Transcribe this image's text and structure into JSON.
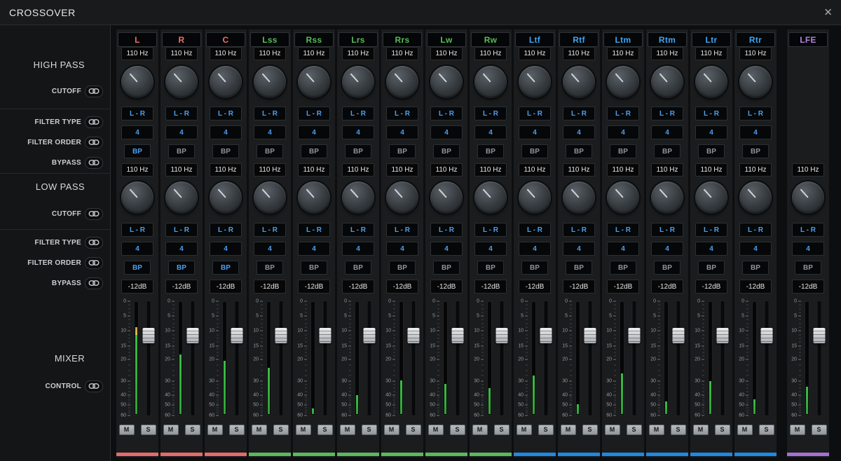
{
  "window": {
    "title": "CROSSOVER",
    "close_glyph": "✕"
  },
  "sidebar": {
    "high_pass": {
      "title": "HIGH PASS",
      "rows": [
        "CUTOFF",
        "FILTER TYPE",
        "FILTER ORDER",
        "BYPASS"
      ]
    },
    "low_pass": {
      "title": "LOW PASS",
      "rows": [
        "CUTOFF",
        "FILTER TYPE",
        "FILTER ORDER",
        "BYPASS"
      ]
    },
    "mixer": {
      "title": "MIXER",
      "rows": [
        "CONTROL"
      ]
    },
    "link_icon": "link-icon"
  },
  "fader_scale": {
    "labels": [
      "0",
      "5",
      "10",
      "15",
      "20",
      "30",
      "40",
      "50",
      "60"
    ],
    "positions": [
      0,
      0.13,
      0.26,
      0.39,
      0.51,
      0.7,
      0.82,
      0.91,
      1.0
    ]
  },
  "colors": {
    "accent": "#4aa0f0",
    "groups": {
      "front": {
        "label": "#f26c6c",
        "bar": "#e76a6a"
      },
      "surround": {
        "label": "#57bb57",
        "bar": "#5cb85c"
      },
      "height": {
        "label": "#3fa4f4",
        "bar": "#1e88e5"
      },
      "lfe": {
        "label": "#b183dc",
        "bar": "#a76fd4"
      }
    }
  },
  "channels": [
    {
      "name": "L",
      "group": "front",
      "hp": {
        "cutoff": "110 Hz",
        "filter_type": "L - R",
        "filter_order": "4",
        "bypass": "BP",
        "bypass_on": true
      },
      "lp": {
        "cutoff": "110 Hz",
        "filter_type": "L - R",
        "filter_order": "4",
        "bypass": "BP",
        "bypass_on": true
      },
      "mixer": {
        "level": "-12dB",
        "fader_pos": 0.3,
        "meter_pct": 77,
        "meter_peak": true
      },
      "mute": "M",
      "solo": "S"
    },
    {
      "name": "R",
      "group": "front",
      "hp": {
        "cutoff": "110 Hz",
        "filter_type": "L - R",
        "filter_order": "4",
        "bypass": "BP",
        "bypass_on": false
      },
      "lp": {
        "cutoff": "110 Hz",
        "filter_type": "L - R",
        "filter_order": "4",
        "bypass": "BP",
        "bypass_on": true
      },
      "mixer": {
        "level": "-12dB",
        "fader_pos": 0.3,
        "meter_pct": 53,
        "meter_peak": false
      },
      "mute": "M",
      "solo": "S"
    },
    {
      "name": "C",
      "group": "front",
      "hp": {
        "cutoff": "110 Hz",
        "filter_type": "L - R",
        "filter_order": "4",
        "bypass": "BP",
        "bypass_on": false
      },
      "lp": {
        "cutoff": "110 Hz",
        "filter_type": "L - R",
        "filter_order": "4",
        "bypass": "BP",
        "bypass_on": true
      },
      "mixer": {
        "level": "-12dB",
        "fader_pos": 0.3,
        "meter_pct": 47,
        "meter_peak": false
      },
      "mute": "M",
      "solo": "S"
    },
    {
      "name": "Lss",
      "group": "surround",
      "hp": {
        "cutoff": "110 Hz",
        "filter_type": "L - R",
        "filter_order": "4",
        "bypass": "BP",
        "bypass_on": false
      },
      "lp": {
        "cutoff": "110 Hz",
        "filter_type": "L - R",
        "filter_order": "4",
        "bypass": "BP",
        "bypass_on": false
      },
      "mixer": {
        "level": "-12dB",
        "fader_pos": 0.3,
        "meter_pct": 41,
        "meter_peak": false
      },
      "mute": "M",
      "solo": "S"
    },
    {
      "name": "Rss",
      "group": "surround",
      "hp": {
        "cutoff": "110 Hz",
        "filter_type": "L - R",
        "filter_order": "4",
        "bypass": "BP",
        "bypass_on": false
      },
      "lp": {
        "cutoff": "110 Hz",
        "filter_type": "L - R",
        "filter_order": "4",
        "bypass": "BP",
        "bypass_on": false
      },
      "mixer": {
        "level": "-12dB",
        "fader_pos": 0.3,
        "meter_pct": 5,
        "meter_peak": false
      },
      "mute": "M",
      "solo": "S"
    },
    {
      "name": "Lrs",
      "group": "surround",
      "hp": {
        "cutoff": "110 Hz",
        "filter_type": "L - R",
        "filter_order": "4",
        "bypass": "BP",
        "bypass_on": false
      },
      "lp": {
        "cutoff": "110 Hz",
        "filter_type": "L - R",
        "filter_order": "4",
        "bypass": "BP",
        "bypass_on": false
      },
      "mixer": {
        "level": "-12dB",
        "fader_pos": 0.3,
        "meter_pct": 17,
        "meter_peak": false
      },
      "mute": "M",
      "solo": "S"
    },
    {
      "name": "Rrs",
      "group": "surround",
      "hp": {
        "cutoff": "110 Hz",
        "filter_type": "L - R",
        "filter_order": "4",
        "bypass": "BP",
        "bypass_on": false
      },
      "lp": {
        "cutoff": "110 Hz",
        "filter_type": "L - R",
        "filter_order": "4",
        "bypass": "BP",
        "bypass_on": false
      },
      "mixer": {
        "level": "-12dB",
        "fader_pos": 0.3,
        "meter_pct": 30,
        "meter_peak": false
      },
      "mute": "M",
      "solo": "S"
    },
    {
      "name": "Lw",
      "group": "surround",
      "hp": {
        "cutoff": "110 Hz",
        "filter_type": "L - R",
        "filter_order": "4",
        "bypass": "BP",
        "bypass_on": false
      },
      "lp": {
        "cutoff": "110 Hz",
        "filter_type": "L - R",
        "filter_order": "4",
        "bypass": "BP",
        "bypass_on": false
      },
      "mixer": {
        "level": "-12dB",
        "fader_pos": 0.3,
        "meter_pct": 27,
        "meter_peak": false
      },
      "mute": "M",
      "solo": "S"
    },
    {
      "name": "Rw",
      "group": "surround",
      "hp": {
        "cutoff": "110 Hz",
        "filter_type": "L - R",
        "filter_order": "4",
        "bypass": "BP",
        "bypass_on": false
      },
      "lp": {
        "cutoff": "110 Hz",
        "filter_type": "L - R",
        "filter_order": "4",
        "bypass": "BP",
        "bypass_on": false
      },
      "mixer": {
        "level": "-12dB",
        "fader_pos": 0.3,
        "meter_pct": 23,
        "meter_peak": false
      },
      "mute": "M",
      "solo": "S"
    },
    {
      "name": "Ltf",
      "group": "height",
      "hp": {
        "cutoff": "110 Hz",
        "filter_type": "L - R",
        "filter_order": "4",
        "bypass": "BP",
        "bypass_on": false
      },
      "lp": {
        "cutoff": "110 Hz",
        "filter_type": "L - R",
        "filter_order": "4",
        "bypass": "BP",
        "bypass_on": false
      },
      "mixer": {
        "level": "-12dB",
        "fader_pos": 0.3,
        "meter_pct": 34,
        "meter_peak": false
      },
      "mute": "M",
      "solo": "S"
    },
    {
      "name": "Rtf",
      "group": "height",
      "hp": {
        "cutoff": "110 Hz",
        "filter_type": "L - R",
        "filter_order": "4",
        "bypass": "BP",
        "bypass_on": false
      },
      "lp": {
        "cutoff": "110 Hz",
        "filter_type": "L - R",
        "filter_order": "4",
        "bypass": "BP",
        "bypass_on": false
      },
      "mixer": {
        "level": "-12dB",
        "fader_pos": 0.3,
        "meter_pct": 9,
        "meter_peak": false
      },
      "mute": "M",
      "solo": "S"
    },
    {
      "name": "Ltm",
      "group": "height",
      "hp": {
        "cutoff": "110 Hz",
        "filter_type": "L - R",
        "filter_order": "4",
        "bypass": "BP",
        "bypass_on": false
      },
      "lp": {
        "cutoff": "110 Hz",
        "filter_type": "L - R",
        "filter_order": "4",
        "bypass": "BP",
        "bypass_on": false
      },
      "mixer": {
        "level": "-12dB",
        "fader_pos": 0.3,
        "meter_pct": 36,
        "meter_peak": false
      },
      "mute": "M",
      "solo": "S"
    },
    {
      "name": "Rtm",
      "group": "height",
      "hp": {
        "cutoff": "110 Hz",
        "filter_type": "L - R",
        "filter_order": "4",
        "bypass": "BP",
        "bypass_on": false
      },
      "lp": {
        "cutoff": "110 Hz",
        "filter_type": "L - R",
        "filter_order": "4",
        "bypass": "BP",
        "bypass_on": false
      },
      "mixer": {
        "level": "-12dB",
        "fader_pos": 0.3,
        "meter_pct": 11,
        "meter_peak": false
      },
      "mute": "M",
      "solo": "S"
    },
    {
      "name": "Ltr",
      "group": "height",
      "hp": {
        "cutoff": "110 Hz",
        "filter_type": "L - R",
        "filter_order": "4",
        "bypass": "BP",
        "bypass_on": false
      },
      "lp": {
        "cutoff": "110 Hz",
        "filter_type": "L - R",
        "filter_order": "4",
        "bypass": "BP",
        "bypass_on": false
      },
      "mixer": {
        "level": "-12dB",
        "fader_pos": 0.3,
        "meter_pct": 29,
        "meter_peak": false
      },
      "mute": "M",
      "solo": "S"
    },
    {
      "name": "Rtr",
      "group": "height",
      "hp": {
        "cutoff": "110 Hz",
        "filter_type": "L - R",
        "filter_order": "4",
        "bypass": "BP",
        "bypass_on": false
      },
      "lp": {
        "cutoff": "110 Hz",
        "filter_type": "L - R",
        "filter_order": "4",
        "bypass": "BP",
        "bypass_on": false
      },
      "mixer": {
        "level": "-12dB",
        "fader_pos": 0.3,
        "meter_pct": 13,
        "meter_peak": false
      },
      "mute": "M",
      "solo": "S"
    },
    {
      "name": "LFE",
      "group": "lfe",
      "hp": null,
      "lp": {
        "cutoff": "110 Hz",
        "filter_type": "L - R",
        "filter_order": "4",
        "bypass": "BP",
        "bypass_on": false
      },
      "mixer": {
        "level": "-12dB",
        "fader_pos": 0.3,
        "meter_pct": 24,
        "meter_peak": false
      },
      "mute": "M",
      "solo": "S"
    }
  ]
}
